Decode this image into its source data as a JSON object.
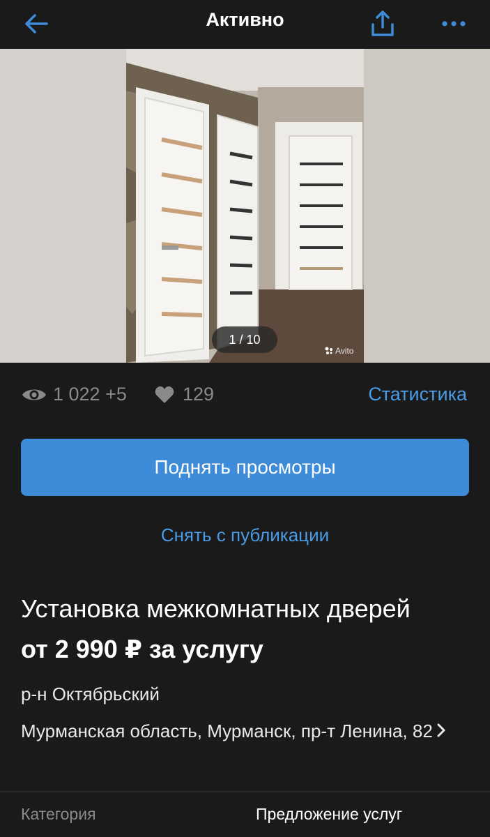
{
  "header": {
    "title": "Активно"
  },
  "gallery": {
    "counter": "1 / 10",
    "watermark": "Avito"
  },
  "stats": {
    "views": "1 022 +5",
    "likes": "129",
    "link": "Статистика"
  },
  "actions": {
    "promote": "Поднять просмотры",
    "unpublish": "Снять с публикации"
  },
  "listing": {
    "title": "Установка межкомнатных дверей",
    "price": "от 2 990 ₽ за услугу",
    "district": "р-н Октябрьский",
    "address": "Мурманская область, Мурманск, пр-т Ленина, 82"
  },
  "details": {
    "category_label": "Категория",
    "category_value": "Предложение услуг"
  },
  "colors": {
    "background": "#1a1a1a",
    "accent": "#3d8bd9",
    "link": "#4a9be6",
    "muted": "#8a8a8a"
  },
  "icons": [
    "back-arrow-icon",
    "share-icon",
    "more-icon",
    "eye-icon",
    "heart-icon",
    "chevron-right-icon"
  ]
}
